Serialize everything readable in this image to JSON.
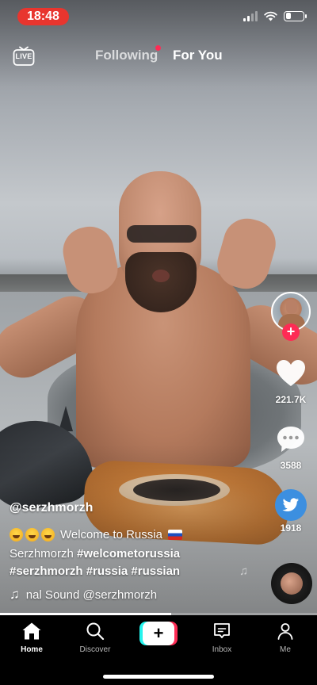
{
  "status_bar": {
    "time": "18:48",
    "battery_level": 0.3
  },
  "top_nav": {
    "live_label": "LIVE",
    "tabs": [
      {
        "label": "Following",
        "has_notification_dot": true
      },
      {
        "label": "For You",
        "active": true
      }
    ]
  },
  "actions": {
    "like_count": "221.7K",
    "comment_count": "3588",
    "share_count": "1918"
  },
  "caption": {
    "username": "@serzhmorzh",
    "title": "Welcome to Russia",
    "line2_prefix": "Serzhmorzh",
    "line2_tag": "#welcometorussia",
    "line3": "#serzhmorzh #russia #russian",
    "sound": "nal Sound     @serzhmorzh"
  },
  "video_progress": 0.54,
  "tabbar": {
    "items": [
      {
        "label": "Home",
        "icon": "home-icon",
        "active": true
      },
      {
        "label": "Discover",
        "icon": "search-icon"
      },
      {
        "label": "",
        "icon": "create-plus-icon"
      },
      {
        "label": "Inbox",
        "icon": "inbox-icon"
      },
      {
        "label": "Me",
        "icon": "profile-icon"
      }
    ]
  },
  "colors": {
    "accent_red": "#fe2c55",
    "accent_cyan": "#25f4ee",
    "status_time_bg": "#e8352e",
    "share_blue": "#3c8fe0"
  }
}
